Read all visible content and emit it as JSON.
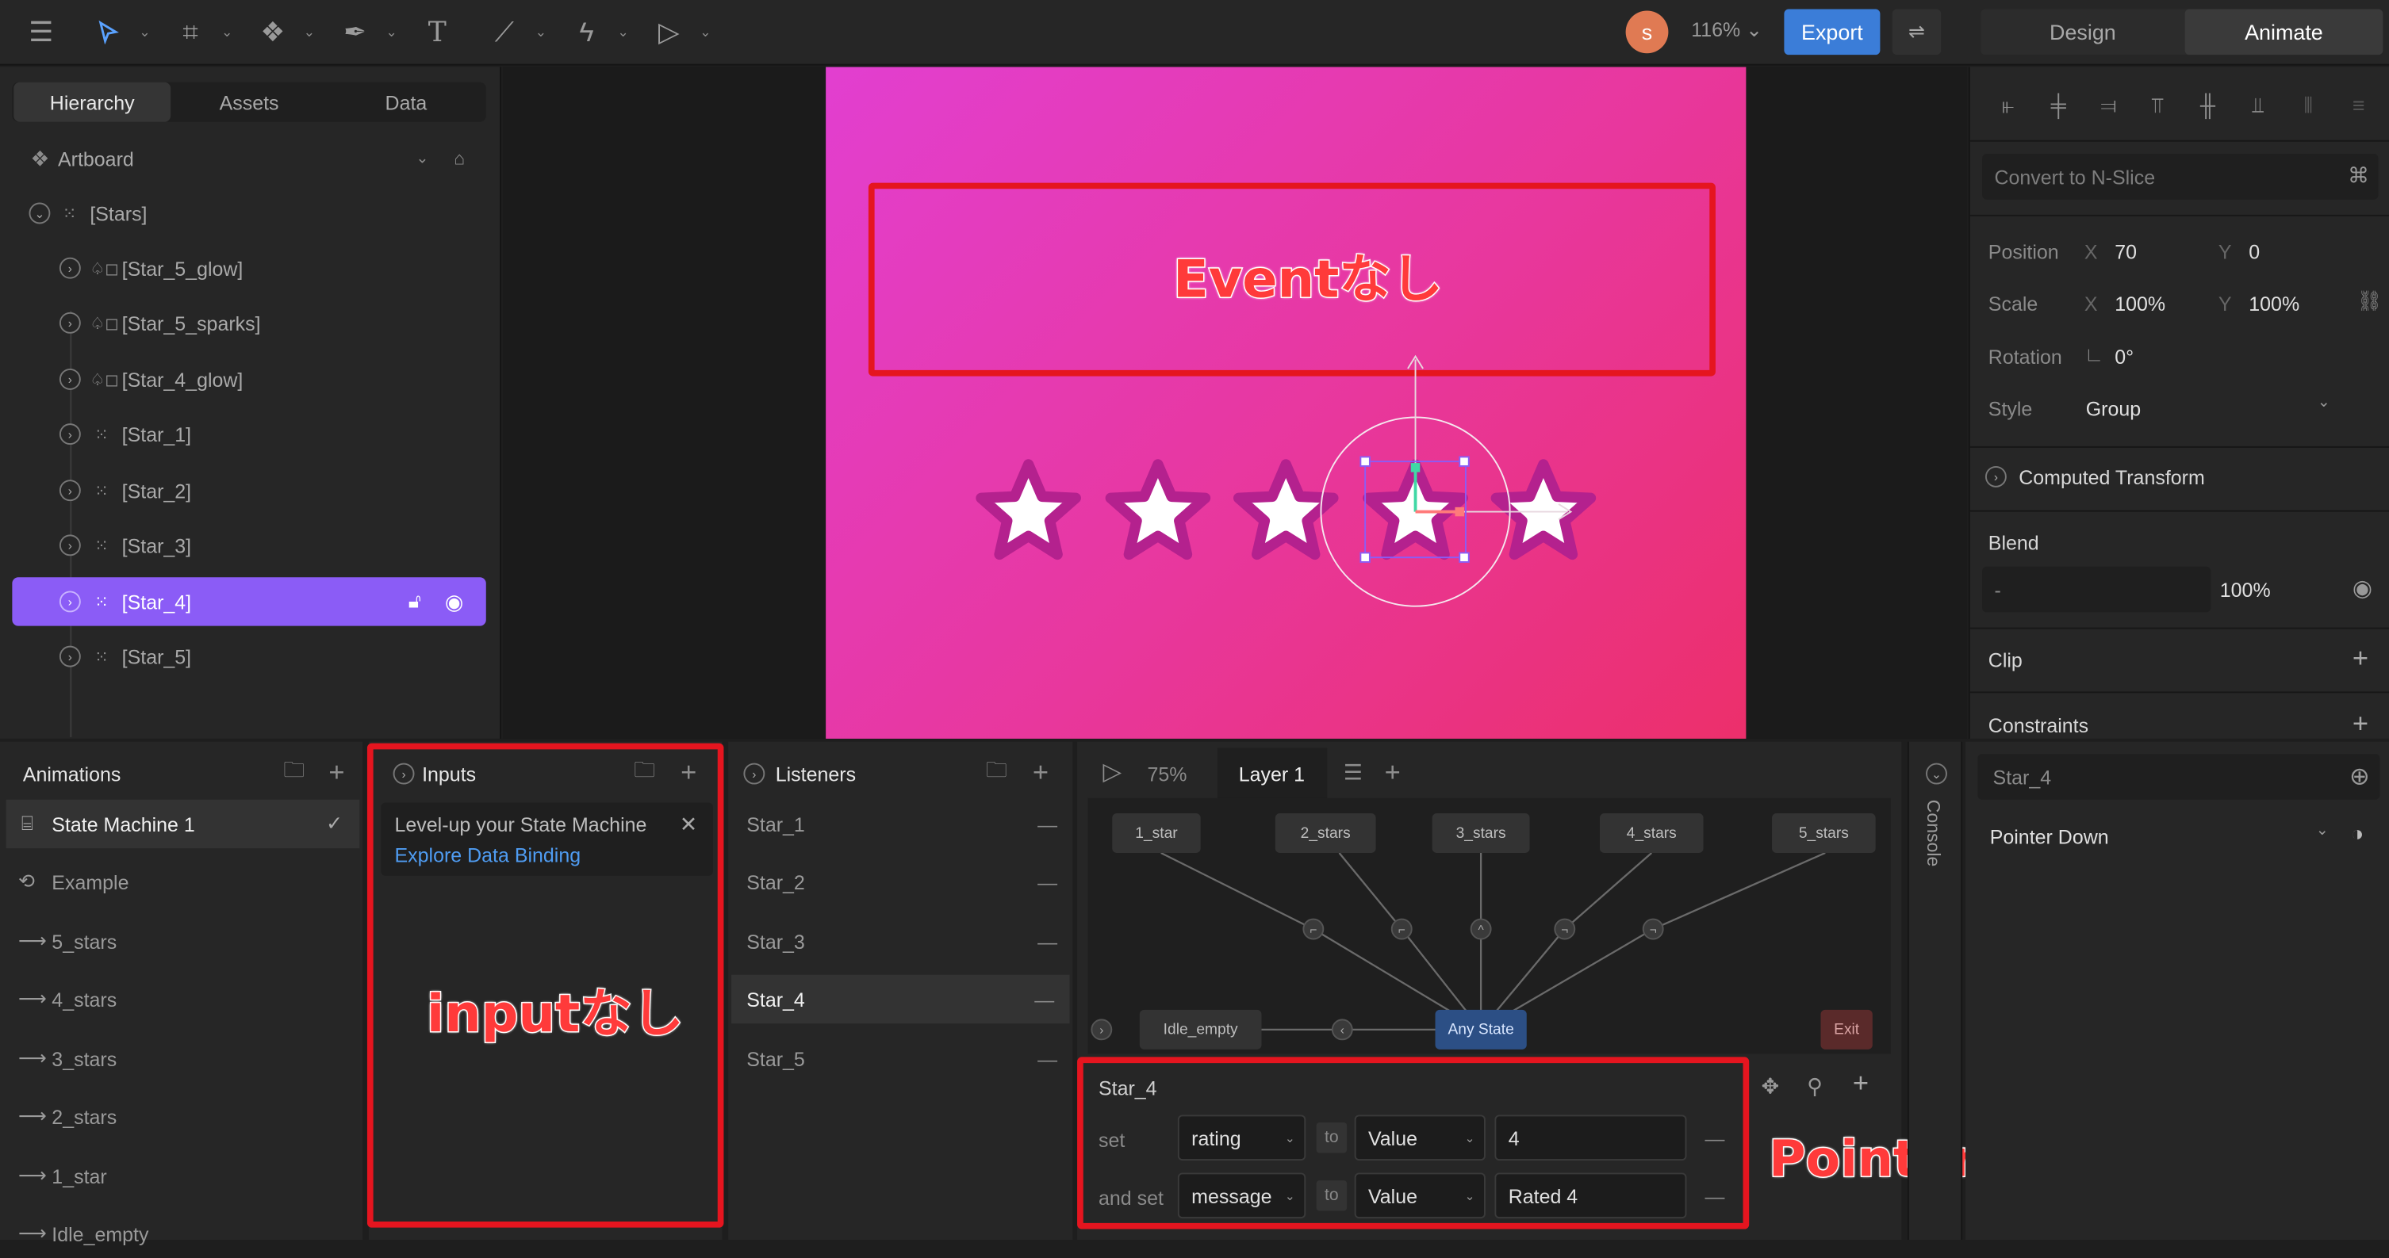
{
  "toolbar": {
    "avatar_initial": "s",
    "zoom": "116% ⌄",
    "export": "Export",
    "modes": [
      "Design",
      "Animate"
    ]
  },
  "hierarchy": {
    "tabs": [
      "Hierarchy",
      "Assets",
      "Data"
    ],
    "artboard": "Artboard",
    "items": [
      "[Stars]",
      "[Star_5_glow]",
      "[Star_5_sparks]",
      "[Star_4_glow]",
      "[Star_1]",
      "[Star_2]",
      "[Star_3]",
      "[Star_4]",
      "[Star_5]"
    ]
  },
  "annotations": {
    "event": "Eventなし",
    "input": "inputなし",
    "pointer": "Pointer Down時の変化"
  },
  "properties": {
    "convert": "Convert to N-Slice",
    "position_label": "Position",
    "position_x": "70",
    "position_y": "0",
    "scale_label": "Scale",
    "scale_x": "100%",
    "scale_y": "100%",
    "rotation_label": "Rotation",
    "rotation": "0°",
    "style_label": "Style",
    "style": "Group",
    "computed": "Computed Transform",
    "blend": "Blend",
    "blend_mode": "-",
    "blend_pct": "100%",
    "clip": "Clip",
    "constraints": "Constraints",
    "axis_x": "X",
    "axis_y": "Y"
  },
  "animations": {
    "title": "Animations",
    "items": [
      "State Machine 1",
      "Example",
      "5_stars",
      "4_stars",
      "3_stars",
      "2_stars",
      "1_star",
      "Idle_empty"
    ]
  },
  "inputs": {
    "title": "Inputs",
    "promo": "Level-up your State Machine",
    "promo_link": "Explore Data Binding"
  },
  "listeners": {
    "title": "Listeners",
    "items": [
      "Star_1",
      "Star_2",
      "Star_3",
      "Star_4",
      "Star_5"
    ]
  },
  "state_machine": {
    "speed": "75%",
    "layer": "Layer 1",
    "nodes": [
      "1_star",
      "2_stars",
      "3_stars",
      "4_stars",
      "5_stars"
    ],
    "idle": "Idle_empty",
    "any": "Any State",
    "exit": "Exit"
  },
  "listener_detail": {
    "target": "Star_4",
    "set": "set",
    "and_set": "and set",
    "to": "to",
    "row1": {
      "field": "rating",
      "mode": "Value",
      "value": "4"
    },
    "row2": {
      "field": "message",
      "mode": "Value",
      "value": "Rated 4"
    }
  },
  "console": "Console",
  "listener_props": {
    "target": "Star_4",
    "event": "Pointer Down"
  }
}
